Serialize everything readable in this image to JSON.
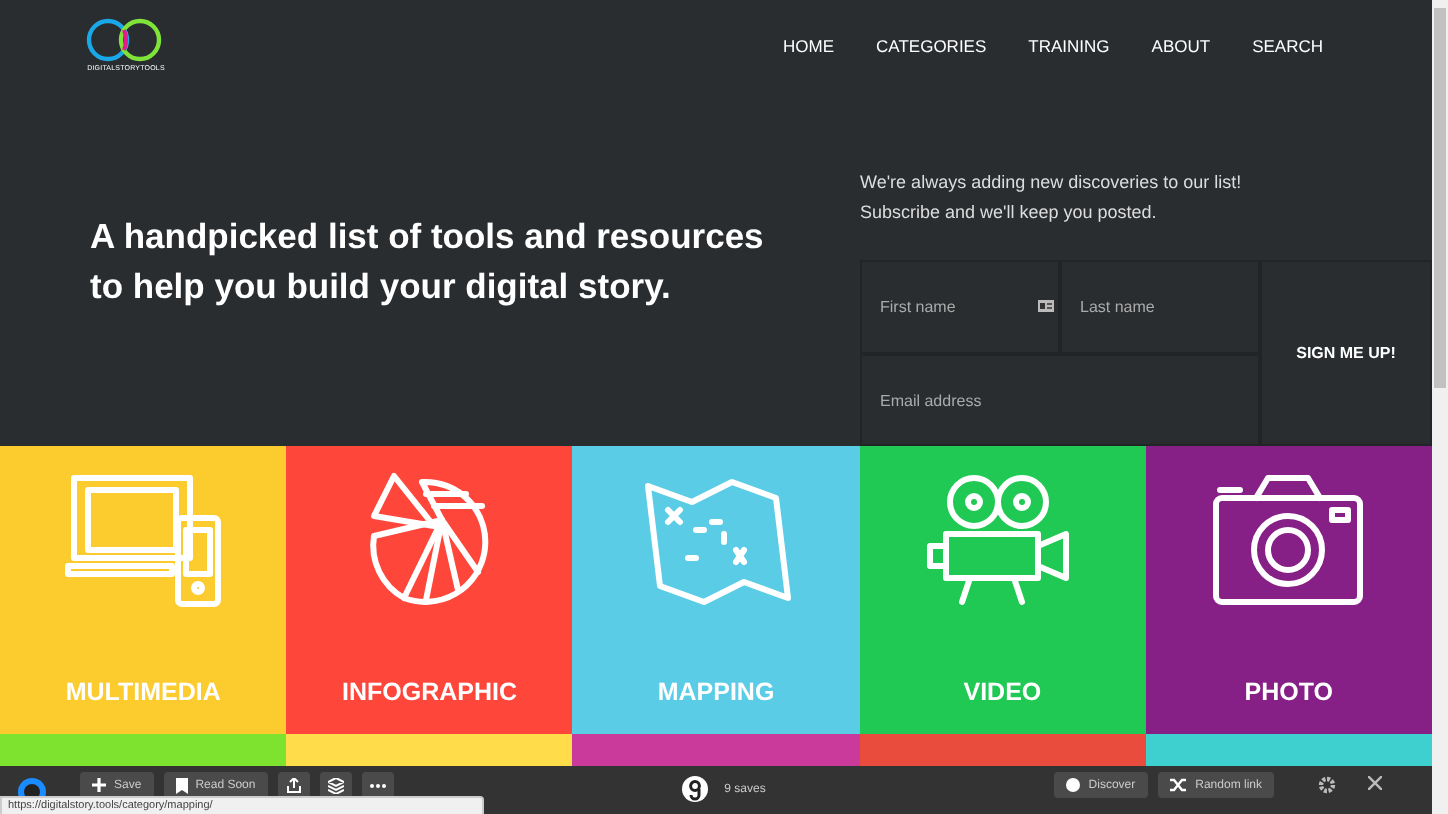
{
  "logo": {
    "text": "DIGITALSTORYTOOLS"
  },
  "nav": [
    "HOME",
    "CATEGORIES",
    "TRAINING",
    "ABOUT",
    "SEARCH"
  ],
  "hero": {
    "title": "A handpicked list of tools and resources to help you build your digital story."
  },
  "subscribe": {
    "text": "We're always adding new discoveries to our list! Subscribe and we'll keep you posted.",
    "first_name": {
      "placeholder": "First name"
    },
    "last_name": {
      "placeholder": "Last name"
    },
    "email": {
      "placeholder": "Email address"
    },
    "button": "SIGN ME UP!"
  },
  "categories": [
    {
      "kind": "multimedia",
      "label": "MULTIMEDIA",
      "color": "#fccb2e"
    },
    {
      "kind": "infographic",
      "label": "INFOGRAPHIC",
      "color": "#fe463a"
    },
    {
      "kind": "mapping",
      "label": "MAPPING",
      "color": "#5bcce6"
    },
    {
      "kind": "video",
      "label": "VIDEO",
      "color": "#20c953"
    },
    {
      "kind": "photo",
      "label": "PHOTO",
      "color": "#861f86"
    }
  ],
  "next_row": [
    {
      "color": "#7ee32e"
    },
    {
      "color": "#ffdd4a"
    },
    {
      "color": "#c93a9b"
    },
    {
      "color": "#e94b3c"
    },
    {
      "color": "#3ecfcf"
    }
  ],
  "toolbar": {
    "save": "Save",
    "read_soon": "Read Soon",
    "saves": "9 saves",
    "discover": "Discover",
    "random": "Random link"
  },
  "status_url": "https://digitalstory.tools/category/mapping/"
}
